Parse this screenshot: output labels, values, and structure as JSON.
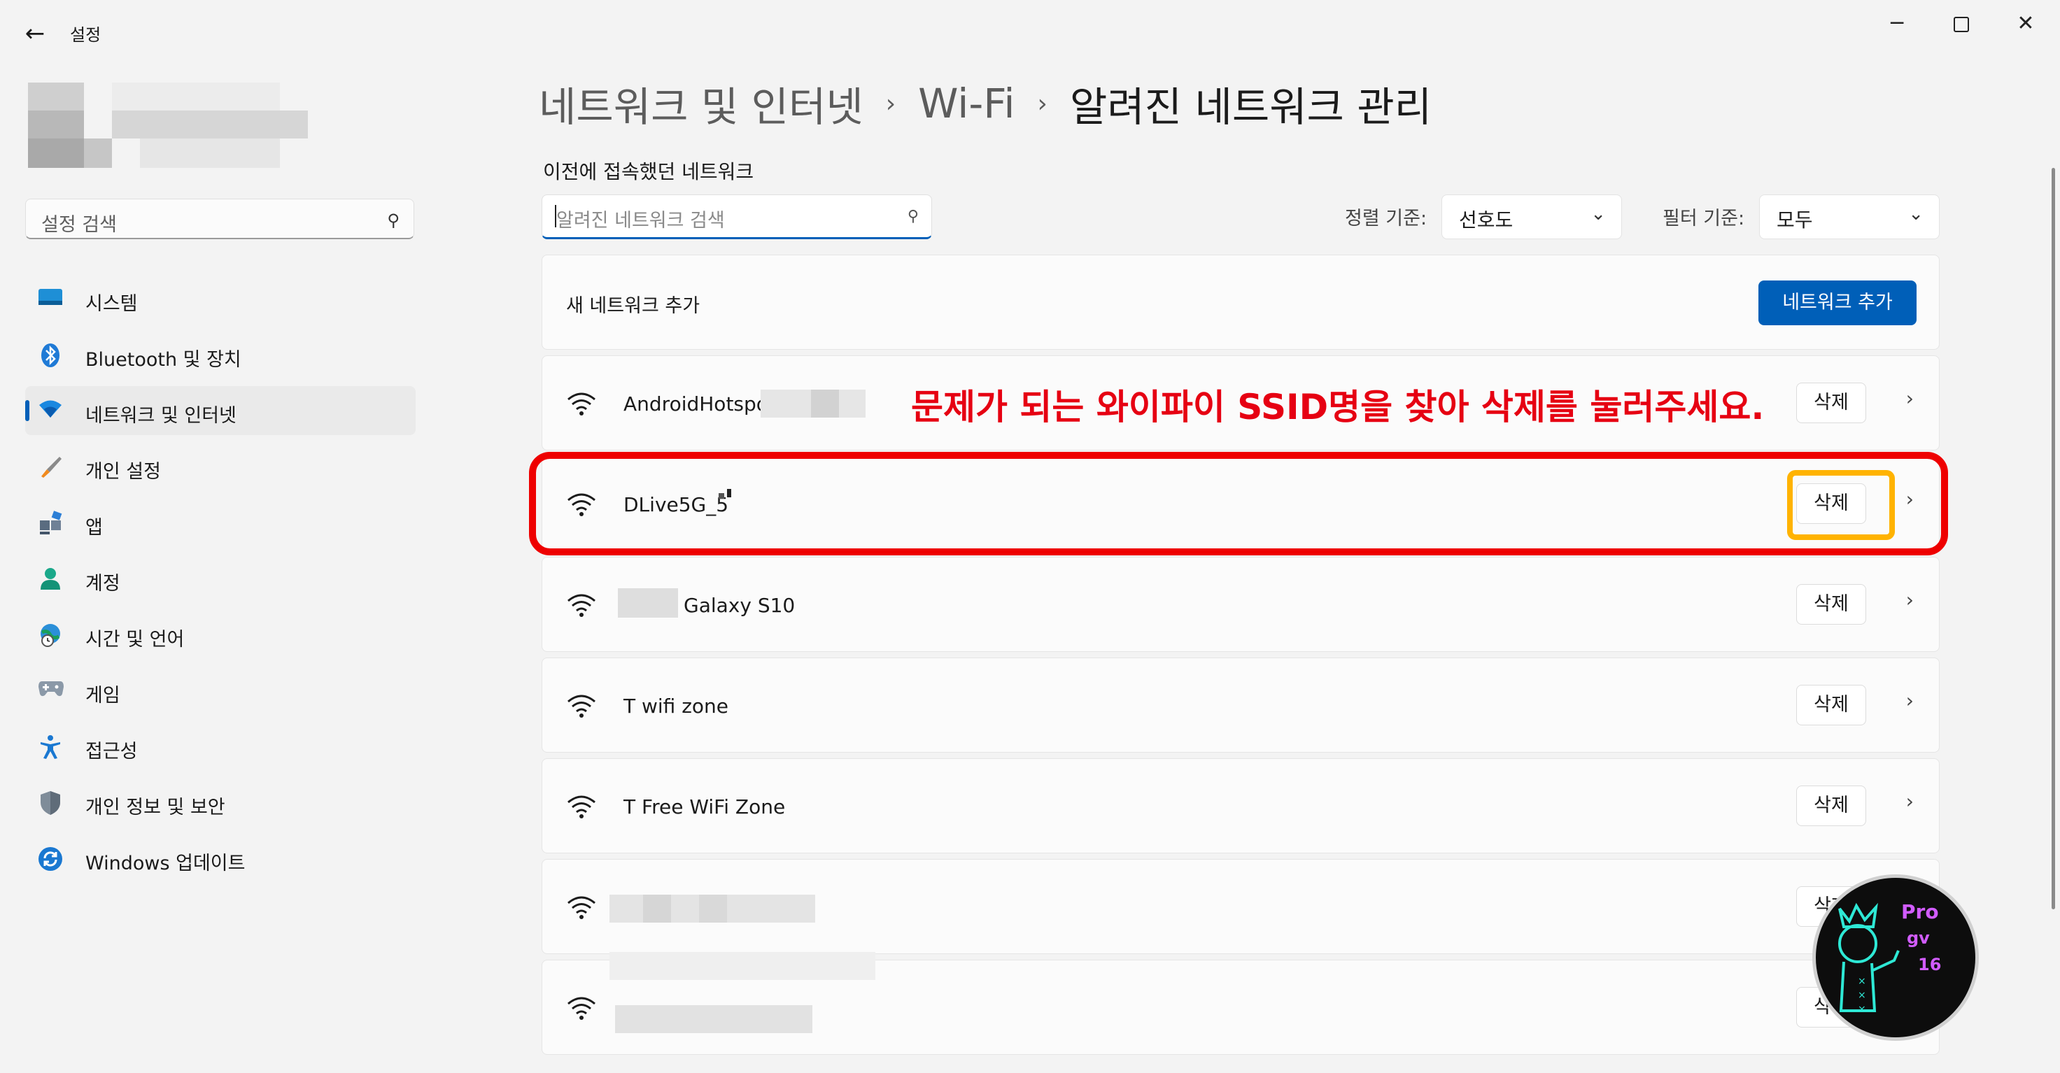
{
  "window": {
    "title": "설정",
    "back_icon": "arrow-left-icon",
    "minimize": "─",
    "close": "✕"
  },
  "sidebar": {
    "search_placeholder": "설정 검색",
    "search_icon": "🔍",
    "items": [
      {
        "label": "시스템",
        "icon": "monitor-icon"
      },
      {
        "label": "Bluetooth 및 장치",
        "icon": "bluetooth-icon"
      },
      {
        "label": "네트워크 및 인터넷",
        "icon": "wifi-icon",
        "selected": true
      },
      {
        "label": "개인 설정",
        "icon": "brush-icon"
      },
      {
        "label": "앱",
        "icon": "apps-icon"
      },
      {
        "label": "계정",
        "icon": "person-icon"
      },
      {
        "label": "시간 및 언어",
        "icon": "globe-clock-icon"
      },
      {
        "label": "게임",
        "icon": "gamepad-icon"
      },
      {
        "label": "접근성",
        "icon": "accessibility-icon"
      },
      {
        "label": "개인 정보 및 보안",
        "icon": "shield-icon"
      },
      {
        "label": "Windows 업데이트",
        "icon": "update-icon"
      }
    ]
  },
  "breadcrumb": {
    "items": [
      "네트워크 및 인터넷",
      "Wi-Fi"
    ],
    "current": "알려진 네트워크 관리",
    "separator": "›"
  },
  "main": {
    "section_label": "이전에 접속했던 네트워크",
    "search_placeholder": "알려진 네트워크 검색",
    "sort_label": "정렬 기준:",
    "sort_value": "선호도",
    "filter_label": "필터 기준:",
    "filter_value": "모두",
    "add_network_text": "새 네트워크 추가",
    "add_network_button": "네트워크 추가",
    "delete_label": "삭제",
    "networks": [
      {
        "ssid": "AndroidHotspo"
      },
      {
        "ssid": "DLive5G_5"
      },
      {
        "ssid": "Galaxy S10"
      },
      {
        "ssid": "T wifi zone"
      },
      {
        "ssid": "T Free WiFi Zone"
      },
      {
        "ssid": ""
      },
      {
        "ssid": ""
      }
    ]
  },
  "annotation": {
    "text": "문제가 되는 와이파이 SSID명을 찾아 삭제를 눌러주세요.",
    "color": "#e60012",
    "highlight_color": "#ffb300"
  },
  "watermark": {
    "line1": "Pro",
    "line2": "gv",
    "line3": "16"
  },
  "colors": {
    "accent": "#005fb8"
  }
}
